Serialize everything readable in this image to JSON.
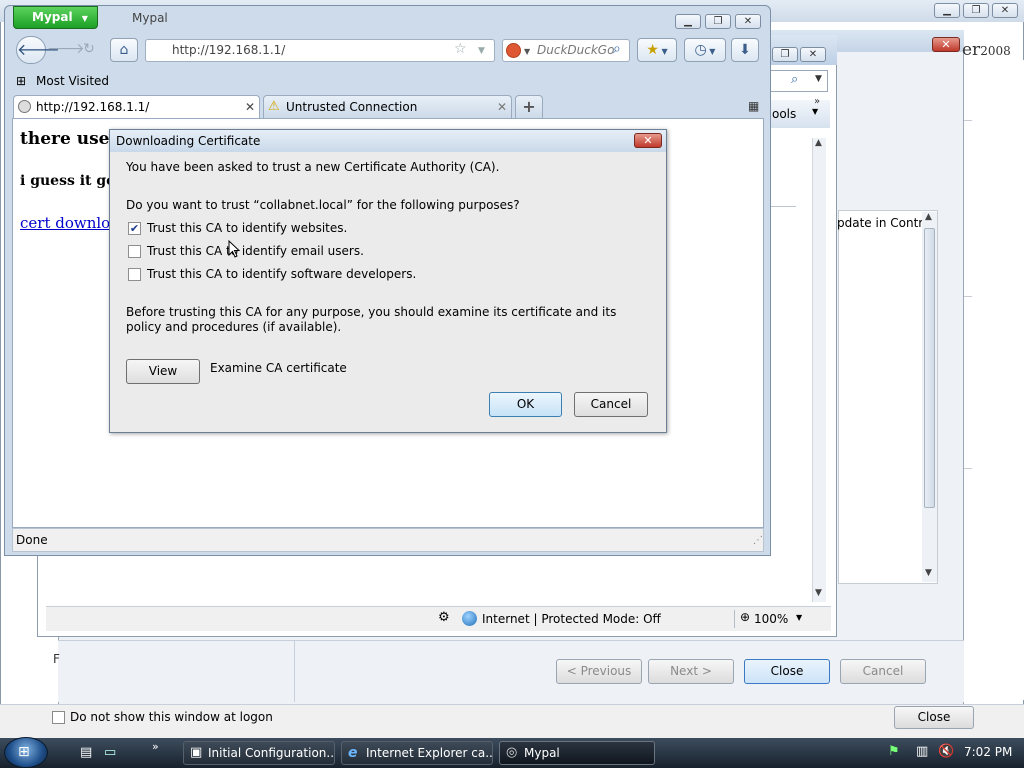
{
  "background_window": {
    "close_button_label": "Close",
    "dont_show_label": "Do not show this window at logon",
    "brand_text": "er",
    "brand_year": "2008",
    "wizard_buttons": {
      "previous": "< Previous",
      "next": "Next >",
      "close": "Close",
      "cancel": "Cancel"
    }
  },
  "ie_window": {
    "tools_label": "ools",
    "content_snippet": "pdate in Contro",
    "status_zone": "Internet | Protected Mode: Off",
    "zoom": "100%"
  },
  "firefox": {
    "app_button_label": "Mypal",
    "window_title": "Mypal",
    "url": "http://192.168.1.1/",
    "search_placeholder": "DuckDuckGo",
    "bookmarks": {
      "most_visited": "Most Visited"
    },
    "tabs": [
      {
        "label": "http://192.168.1.1/",
        "selected": true
      },
      {
        "label": "Untrusted Connection",
        "selected": false
      }
    ],
    "page": {
      "heading1": "there used",
      "heading2": "i guess it got",
      "link": "cert download"
    },
    "status": "Done"
  },
  "dialog": {
    "title": "Downloading Certificate",
    "intro": "You have been asked to trust a new Certificate Authority (CA).",
    "question": "Do you want to trust “collabnet.local” for the following purposes?",
    "options": [
      {
        "label": "Trust this CA to identify websites.",
        "checked": true
      },
      {
        "label": "Trust this CA to identify email users.",
        "checked": false
      },
      {
        "label": "Trust this CA to identify software developers.",
        "checked": false
      }
    ],
    "advice": "Before trusting this CA for any purpose, you should examine its certificate and its policy and procedures (if available).",
    "view_button": "View",
    "view_label": "Examine CA certificate",
    "ok_button": "OK",
    "cancel_button": "Cancel"
  },
  "taskbar": {
    "items": [
      {
        "label": "Initial Configuration...",
        "icon": "config-icon"
      },
      {
        "label": "Internet Explorer ca...",
        "icon": "ie-icon"
      },
      {
        "label": "Mypal",
        "icon": "mypal-icon",
        "active": true
      }
    ],
    "clock": "7:02 PM"
  },
  "colors": {
    "firefox_button": "#1d9f24",
    "dialog_close": "#c0392b",
    "link": "#0000cc",
    "taskbar": "#17212c"
  }
}
